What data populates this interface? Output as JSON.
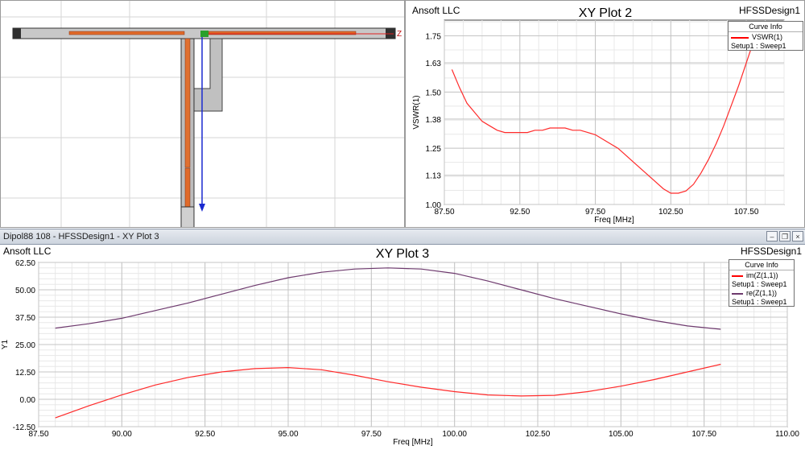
{
  "model_view": {
    "axis_label": "Z"
  },
  "plot2": {
    "vendor": "Ansoft LLC",
    "title": "XY Plot 2",
    "design": "HFSSDesign1",
    "legend": {
      "title": "Curve Info",
      "entries": [
        {
          "name": "VSWR(1)",
          "sub": "Setup1 : Sweep1",
          "color": "#ff2a2a"
        }
      ]
    }
  },
  "window": {
    "title": "Dipol88 108 - HFSSDesign1 - XY Plot 3"
  },
  "plot3": {
    "vendor": "Ansoft LLC",
    "title": "XY Plot 3",
    "design": "HFSSDesign1",
    "legend": {
      "title": "Curve Info",
      "entries": [
        {
          "name": "im(Z(1,1))",
          "sub": "Setup1 : Sweep1",
          "color": "#ff2a2a"
        },
        {
          "name": "re(Z(1,1))",
          "sub": "Setup1 : Sweep1",
          "color": "#6e3a6e"
        }
      ]
    }
  },
  "chart_data": [
    {
      "type": "line",
      "title": "XY Plot 2",
      "xlabel": "Freq [MHz]",
      "ylabel": "VSWR(1)",
      "xlim": [
        87.5,
        110.0
      ],
      "ylim": [
        1.0,
        1.82
      ],
      "xticks": [
        "87.50",
        "92.50",
        "97.50",
        "102.50",
        "107.50"
      ],
      "yticks": [
        "1.00",
        "1.13",
        "1.25",
        "1.38",
        "1.50",
        "1.63",
        "1.75"
      ],
      "grid": true,
      "legend_position": "top-right",
      "series": [
        {
          "name": "VSWR(1)",
          "color": "#ff2a2a",
          "x": [
            88,
            88.5,
            89,
            89.5,
            90,
            90.5,
            91,
            91.5,
            92,
            92.5,
            93,
            93.5,
            94,
            94.5,
            95,
            95.5,
            96,
            96.5,
            97,
            97.5,
            98,
            98.5,
            99,
            99.5,
            100,
            100.5,
            101,
            101.5,
            102,
            102.5,
            103,
            103.5,
            104,
            104.5,
            105,
            105.5,
            106,
            106.5,
            107,
            107.5,
            108
          ],
          "values": [
            1.6,
            1.52,
            1.45,
            1.41,
            1.37,
            1.35,
            1.33,
            1.32,
            1.32,
            1.32,
            1.32,
            1.33,
            1.33,
            1.34,
            1.34,
            1.34,
            1.33,
            1.33,
            1.32,
            1.31,
            1.29,
            1.27,
            1.25,
            1.22,
            1.19,
            1.16,
            1.13,
            1.1,
            1.07,
            1.05,
            1.05,
            1.06,
            1.09,
            1.14,
            1.2,
            1.27,
            1.35,
            1.44,
            1.53,
            1.63,
            1.73
          ]
        }
      ]
    },
    {
      "type": "line",
      "title": "XY Plot 3",
      "xlabel": "Freq [MHz]",
      "ylabel": "Y1",
      "xlim": [
        87.5,
        110.0
      ],
      "ylim": [
        -12.5,
        62.5
      ],
      "xticks": [
        "87.50",
        "90.00",
        "92.50",
        "95.00",
        "97.50",
        "100.00",
        "102.50",
        "105.00",
        "107.50",
        "110.00"
      ],
      "yticks": [
        "-12.50",
        "0.00",
        "12.50",
        "25.00",
        "37.50",
        "50.00",
        "62.50"
      ],
      "grid": true,
      "legend_position": "top-right",
      "series": [
        {
          "name": "im(Z(1,1))",
          "color": "#ff2a2a",
          "x": [
            88,
            89,
            90,
            91,
            92,
            93,
            94,
            95,
            96,
            97,
            98,
            99,
            100,
            101,
            102,
            103,
            104,
            105,
            106,
            107,
            108
          ],
          "values": [
            -8.5,
            -3,
            2,
            6.5,
            10,
            12.5,
            14,
            14.5,
            13.5,
            11,
            8,
            5.5,
            3.5,
            2,
            1.5,
            1.8,
            3.5,
            6,
            9,
            12.5,
            16
          ]
        },
        {
          "name": "re(Z(1,1))",
          "color": "#6e3a6e",
          "x": [
            88,
            89,
            90,
            91,
            92,
            93,
            94,
            95,
            96,
            97,
            98,
            99,
            100,
            101,
            102,
            103,
            104,
            105,
            106,
            107,
            108
          ],
          "values": [
            32.5,
            34.5,
            37,
            40.5,
            44,
            48,
            52,
            55.5,
            58,
            59.5,
            60,
            59.5,
            57.5,
            54,
            50,
            46,
            42.5,
            39,
            36,
            33.5,
            32
          ]
        }
      ]
    }
  ]
}
